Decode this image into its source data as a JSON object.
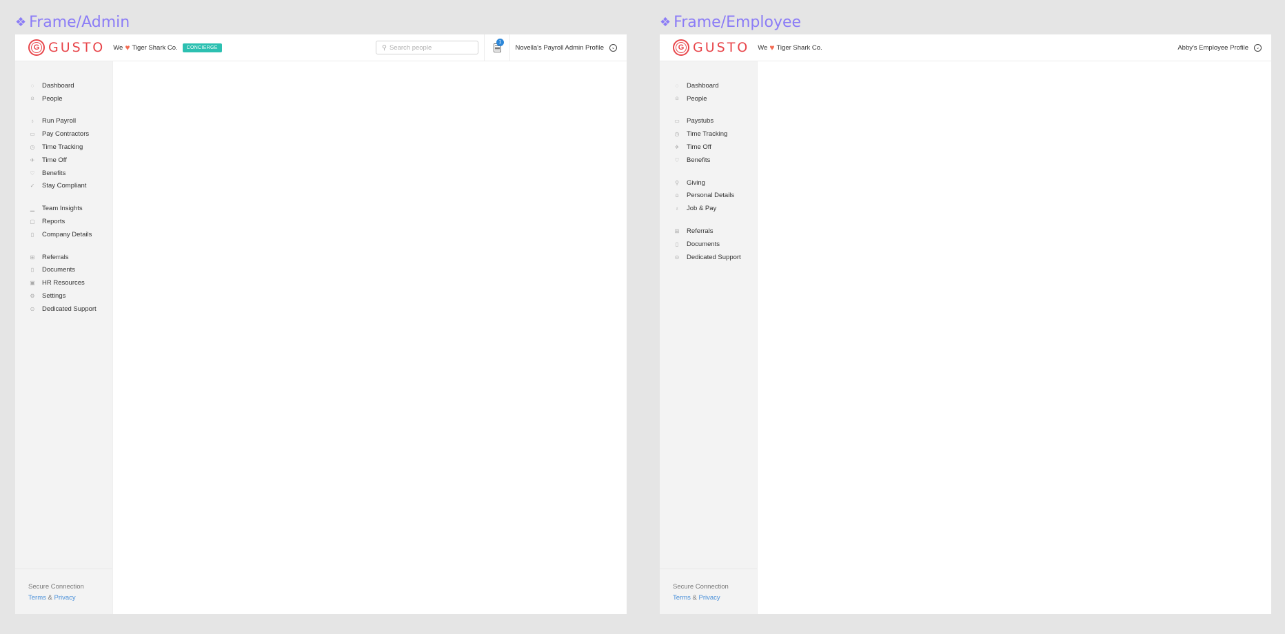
{
  "frames": {
    "admin": {
      "label": "Frame/Admin",
      "logo_mark": "G",
      "logo_text": "GUSTO",
      "tagline_we": "We",
      "tagline_company": "Tiger Shark Co.",
      "badge": "CONCIERGE",
      "search_placeholder": "Search people",
      "notification_count": "1",
      "profile_label": "Novella's Payroll Admin Profile",
      "nav_groups": [
        [
          {
            "label": "Dashboard",
            "icon": "dashboard-icon"
          },
          {
            "label": "People",
            "icon": "person-icon"
          }
        ],
        [
          {
            "label": "Run Payroll",
            "icon": "money-bag-icon"
          },
          {
            "label": "Pay Contractors",
            "icon": "cash-icon"
          },
          {
            "label": "Time Tracking",
            "icon": "clock-icon"
          },
          {
            "label": "Time Off",
            "icon": "plane-icon"
          },
          {
            "label": "Benefits",
            "icon": "heart-icon"
          },
          {
            "label": "Stay Compliant",
            "icon": "check-icon"
          }
        ],
        [
          {
            "label": "Team Insights",
            "icon": "bar-chart-icon"
          },
          {
            "label": "Reports",
            "icon": "folder-icon"
          },
          {
            "label": "Company Details",
            "icon": "building-icon"
          }
        ],
        [
          {
            "label": "Referrals",
            "icon": "gift-icon"
          },
          {
            "label": "Documents",
            "icon": "document-icon"
          },
          {
            "label": "HR Resources",
            "icon": "book-icon"
          },
          {
            "label": "Settings",
            "icon": "gear-icon"
          },
          {
            "label": "Dedicated Support",
            "icon": "help-icon"
          }
        ]
      ],
      "footer": {
        "secure": "Secure Connection",
        "terms": "Terms",
        "amp": "&",
        "privacy": "Privacy"
      }
    },
    "employee": {
      "label": "Frame/Employee",
      "logo_mark": "G",
      "logo_text": "GUSTO",
      "tagline_we": "We",
      "tagline_company": "Tiger Shark Co.",
      "profile_label": "Abby's Employee Profile",
      "nav_groups": [
        [
          {
            "label": "Dashboard",
            "icon": "dashboard-icon"
          },
          {
            "label": "People",
            "icon": "people-icon"
          }
        ],
        [
          {
            "label": "Paystubs",
            "icon": "cash-icon"
          },
          {
            "label": "Time Tracking",
            "icon": "clock-icon"
          },
          {
            "label": "Time Off",
            "icon": "plane-icon"
          },
          {
            "label": "Benefits",
            "icon": "heart-icon"
          }
        ],
        [
          {
            "label": "Giving",
            "icon": "ribbon-icon"
          },
          {
            "label": "Personal Details",
            "icon": "person-icon"
          },
          {
            "label": "Job & Pay",
            "icon": "money-bag-icon"
          }
        ],
        [
          {
            "label": "Referrals",
            "icon": "gift-icon"
          },
          {
            "label": "Documents",
            "icon": "document-icon"
          },
          {
            "label": "Dedicated Support",
            "icon": "help-icon"
          }
        ]
      ],
      "footer": {
        "secure": "Secure Connection",
        "terms": "Terms",
        "amp": "&",
        "privacy": "Privacy"
      }
    }
  },
  "icon_glyphs": {
    "dashboard-icon": "◌",
    "person-icon": "⍝",
    "people-icon": "⍝",
    "money-bag-icon": "♁",
    "cash-icon": "▭",
    "clock-icon": "◷",
    "plane-icon": "✈",
    "heart-icon": "♡",
    "check-icon": "✓",
    "bar-chart-icon": "▁",
    "folder-icon": "▢",
    "building-icon": "▯",
    "gift-icon": "⊞",
    "document-icon": "▯",
    "book-icon": "▣",
    "gear-icon": "⚙",
    "help-icon": "⊙",
    "ribbon-icon": "⚲"
  },
  "colors": {
    "brand": "#e8454a",
    "accent_link": "#4a90d9",
    "badge": "#2cc0b1",
    "frame_label": "#8b7cf6",
    "notif": "#2d87d8"
  }
}
